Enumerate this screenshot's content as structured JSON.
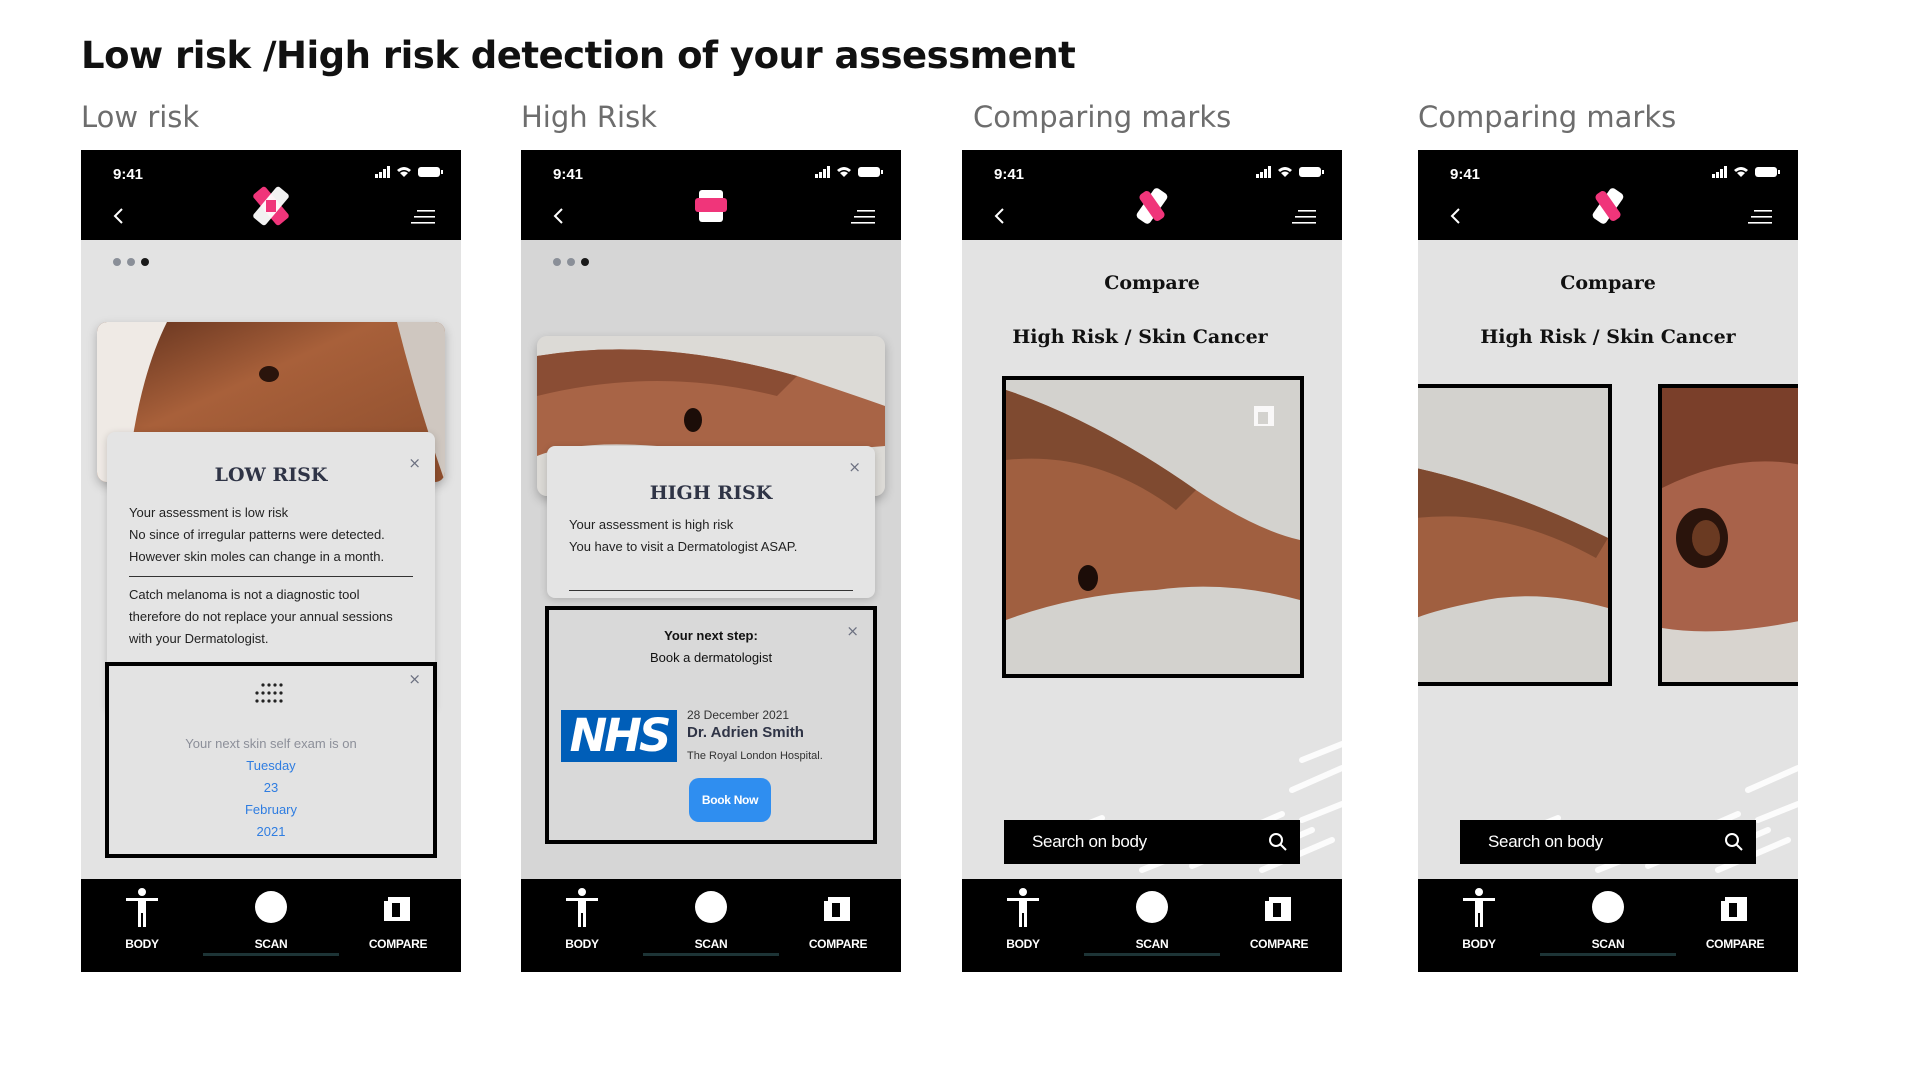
{
  "page": {
    "title": "Low risk /High risk detection of your assessment",
    "screen_labels": [
      "Low risk",
      "High Risk",
      "Comparing marks",
      "Comparing marks"
    ]
  },
  "common": {
    "status_time": "9:41",
    "tabs": {
      "body": "BODY",
      "scan": "SCAN",
      "compare": "COMPARE"
    },
    "logo_colors": {
      "pink": "#f0357a",
      "white": "#ffffff"
    }
  },
  "low_risk": {
    "title": "LOW RISK",
    "close": "×",
    "lines": [
      "Your assessment is low risk",
      "No since of irregular patterns were  detected.",
      "However skin moles can change in a month."
    ],
    "disclaimer": [
      "Catch melanoma is not a diagnostic tool",
      "therefore do not replace your annual sessions",
      "with your Dermatologist."
    ],
    "reminder": {
      "intro": "Your next skin self exam is on",
      "day": "Tuesday",
      "date": "23",
      "month": "February",
      "year": "2021",
      "close": "×"
    }
  },
  "high_risk": {
    "title": "HIGH RISK",
    "close": "×",
    "lines": [
      "Your assessment is high risk",
      "You have to visit a Dermatologist ASAP."
    ],
    "next_step": {
      "title": "Your next step:",
      "subtitle": "Book a dermatologist",
      "close": "×",
      "logo": "NHS",
      "date": "28 December 2021",
      "doctor": "Dr. Adrien Smith",
      "hospital": "The Royal London Hospital.",
      "button": "Book Now"
    }
  },
  "compare": {
    "heading": "Compare",
    "subheading": "High Risk / Skin Cancer",
    "search_placeholder": "Search on body"
  },
  "compare2": {
    "heading": "Compare",
    "subheading": "High Risk / Skin Cancer",
    "search_placeholder": "Search on body"
  }
}
